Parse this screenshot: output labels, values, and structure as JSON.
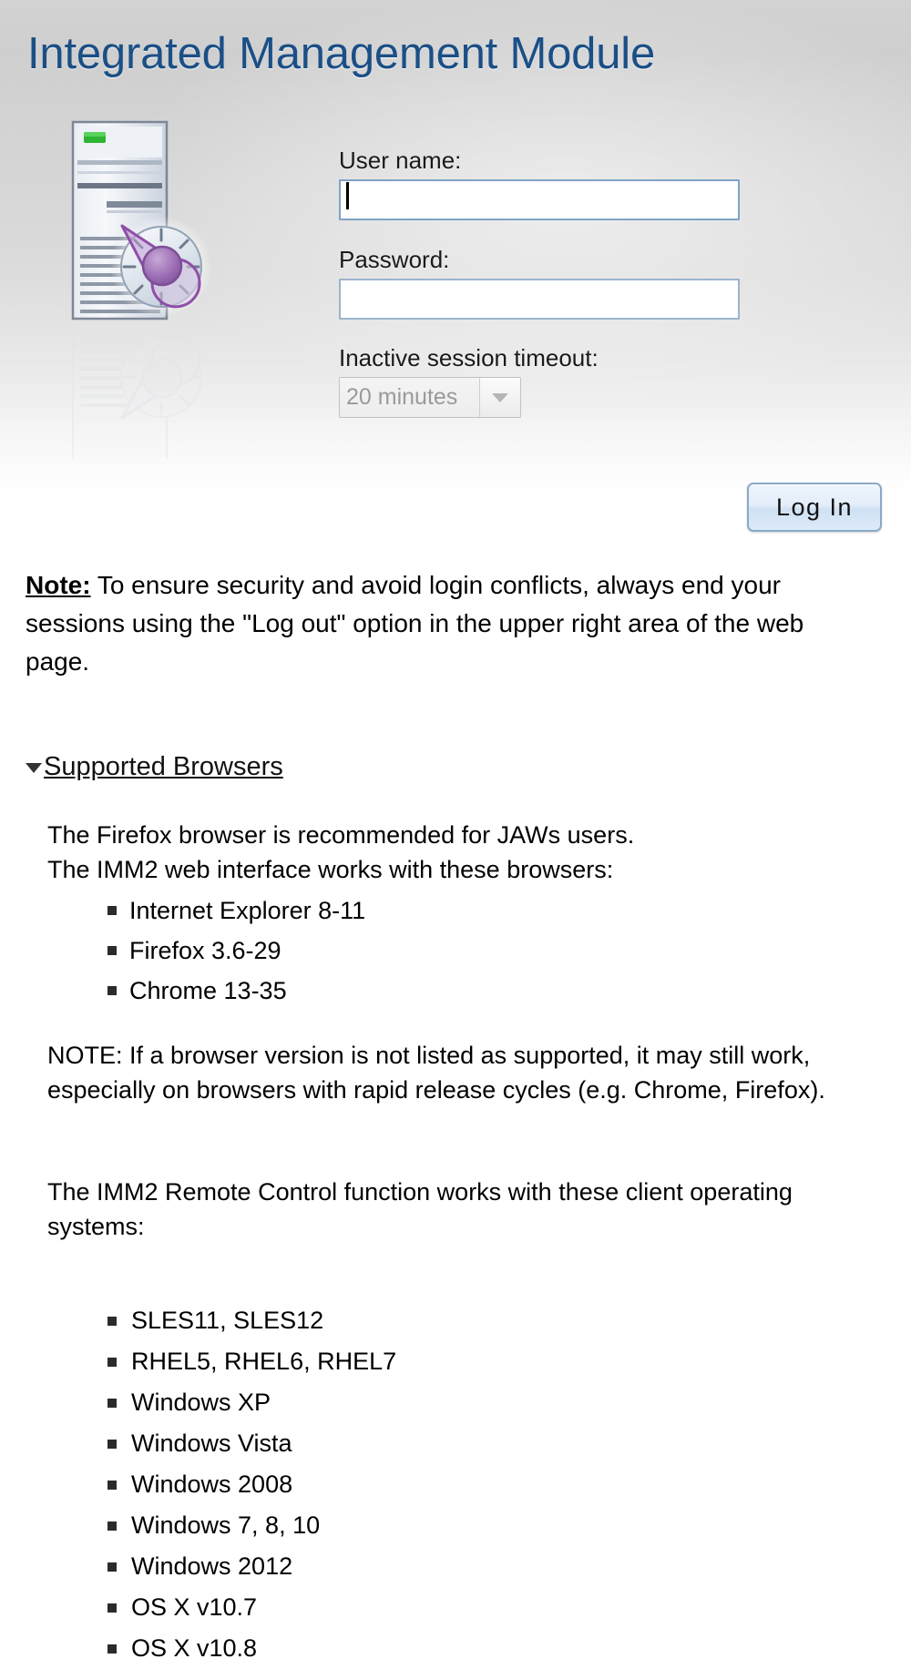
{
  "page": {
    "title": "Integrated Management Module",
    "title_color": "#1b4f86"
  },
  "icon": {
    "server_gauge": "server-gauge-icon"
  },
  "login": {
    "username_label": "User name:",
    "username_value": "",
    "username_placeholder": "",
    "password_label": "Password:",
    "password_value": "",
    "password_placeholder": "",
    "timeout_label": "Inactive session timeout:",
    "timeout_selected": "20 minutes",
    "timeout_options": [
      "20 minutes"
    ],
    "login_button_label": "Log In"
  },
  "note": {
    "label": "Note:",
    "text": "  To ensure security and avoid login conflicts, always end your sessions using the \"Log out\" option in the upper right area of the web page."
  },
  "supported_browsers": {
    "link_label": "Supported Browsers",
    "expanded": true,
    "intro_line1": "The Firefox browser is recommended for JAWs users.",
    "intro_line2": "The IMM2 web interface works with these browsers:",
    "browsers": [
      "Internet Explorer 8-11",
      "Firefox 3.6-29",
      "Chrome 13-35"
    ],
    "note_text": "NOTE: If a browser version is not listed as supported, it may still work, especially on browsers with rapid release cycles (e.g. Chrome, Firefox).",
    "remote_control_intro": "The IMM2 Remote Control function works with these client operating systems:",
    "operating_systems": [
      "SLES11, SLES12",
      "RHEL5, RHEL6, RHEL7",
      "Windows XP",
      "Windows Vista",
      "Windows 2008",
      "Windows 7, 8, 10",
      "Windows 2012",
      "OS X v10.7",
      "OS X v10.8"
    ]
  }
}
